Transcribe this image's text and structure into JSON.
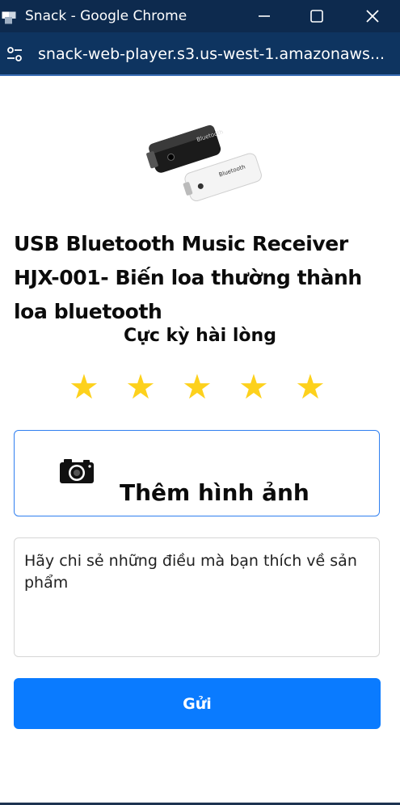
{
  "window": {
    "title": "Snack - Google Chrome",
    "url": "snack-web-player.s3.us-west-1.amazonaws..."
  },
  "product": {
    "title": "USB Bluetooth Music Receiver HJX-001- Biến loa thường thành loa bluetooth",
    "image_icon": "bluetooth-receiver-image"
  },
  "rating": {
    "label": "Cực kỳ hài lòng",
    "value": 5,
    "max": 5,
    "star_color": "#fdd11c"
  },
  "add_photo": {
    "label": "Thêm hình ảnh",
    "icon": "camera-icon",
    "border_color": "#2f7ff0"
  },
  "review": {
    "placeholder": "Hãy chi sẻ những điều mà bạn thích về sản phẩm"
  },
  "submit": {
    "label": "Gửi",
    "color": "#0a7bff"
  },
  "colors": {
    "titlebar": "#0d2a4e",
    "addressbar": "#0e3460"
  }
}
